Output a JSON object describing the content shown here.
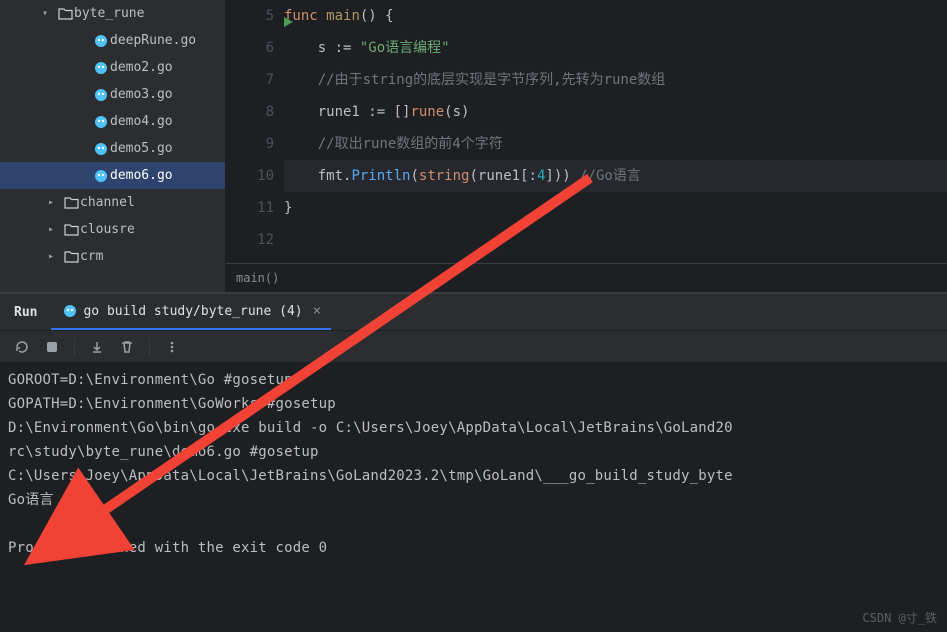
{
  "sidebar": {
    "items": [
      {
        "label": "byte_rune",
        "type": "folder",
        "arrow": "down",
        "indent": "ind1"
      },
      {
        "label": "deepRune.go",
        "type": "go",
        "indent": "ind2"
      },
      {
        "label": "demo2.go",
        "type": "go",
        "indent": "ind2"
      },
      {
        "label": "demo3.go",
        "type": "go",
        "indent": "ind2"
      },
      {
        "label": "demo4.go",
        "type": "go",
        "indent": "ind2"
      },
      {
        "label": "demo5.go",
        "type": "go",
        "indent": "ind2"
      },
      {
        "label": "demo6.go",
        "type": "go",
        "indent": "ind2",
        "selected": true
      },
      {
        "label": "channel",
        "type": "folder",
        "arrow": "right",
        "indent": "ind-f"
      },
      {
        "label": "clousre",
        "type": "folder",
        "arrow": "right",
        "indent": "ind-f"
      },
      {
        "label": "crm",
        "type": "folder",
        "arrow": "right",
        "indent": "ind-f"
      }
    ]
  },
  "editor": {
    "line_start": 5,
    "lines": [
      {
        "n": 5,
        "run": true,
        "html": "<span class='kw'>func</span> <span class='mainfn'>main</span><span class='paren'>()</span> <span class='paren'>{</span>"
      },
      {
        "n": 6,
        "html": "    s <span class='op'>:=</span> <span class='str'>\"Go语言编程\"</span>"
      },
      {
        "n": 7,
        "html": "    <span class='cmt'>//由于string的底层实现是字节序列,先转为rune数组</span>"
      },
      {
        "n": 8,
        "html": "    rune1 <span class='op'>:=</span> <span class='paren'>[]</span><span class='kw'>rune</span><span class='paren'>(</span>s<span class='paren'>)</span>"
      },
      {
        "n": 9,
        "html": "    <span class='cmt'>//取出rune数组的前4个字符</span>"
      },
      {
        "n": 10,
        "hl": true,
        "html": "    fmt.<span class='call'>Println</span><span class='paren'>(</span><span class='kw'>string</span><span class='paren'>(</span>rune1<span class='paren'>[</span>:<span class='num'>4</span><span class='paren'>]</span><span class='paren'>)</span><span class='paren'>)</span> <span class='cmt'>//Go语言</span>"
      },
      {
        "n": 11,
        "html": "<span class='paren'>}</span>"
      },
      {
        "n": 12,
        "html": ""
      }
    ],
    "breadcrumb": "main()"
  },
  "run": {
    "panel_label": "Run",
    "tab_label": "go build study/byte_rune (4)",
    "toolbar": {
      "rerun": "rerun-icon",
      "stop": "stop-icon",
      "scroll": "scroll-icon",
      "delete": "delete-icon",
      "more": "more-icon"
    },
    "console_lines": [
      "GOROOT=D:\\Environment\\Go #gosetup",
      "GOPATH=D:\\Environment\\GoWorks #gosetup",
      "D:\\Environment\\Go\\bin\\go.exe build -o C:\\Users\\Joey\\AppData\\Local\\JetBrains\\GoLand20",
      "rc\\study\\byte_rune\\demo6.go #gosetup",
      "C:\\Users\\Joey\\AppData\\Local\\JetBrains\\GoLand2023.2\\tmp\\GoLand\\___go_build_study_byte",
      "Go语言",
      "",
      "Process finished with the exit code 0"
    ]
  },
  "watermark": "CSDN @寸_铁",
  "icons": {
    "folder_color": "#ced0d6",
    "gopher_color": "#4fc3f7"
  }
}
